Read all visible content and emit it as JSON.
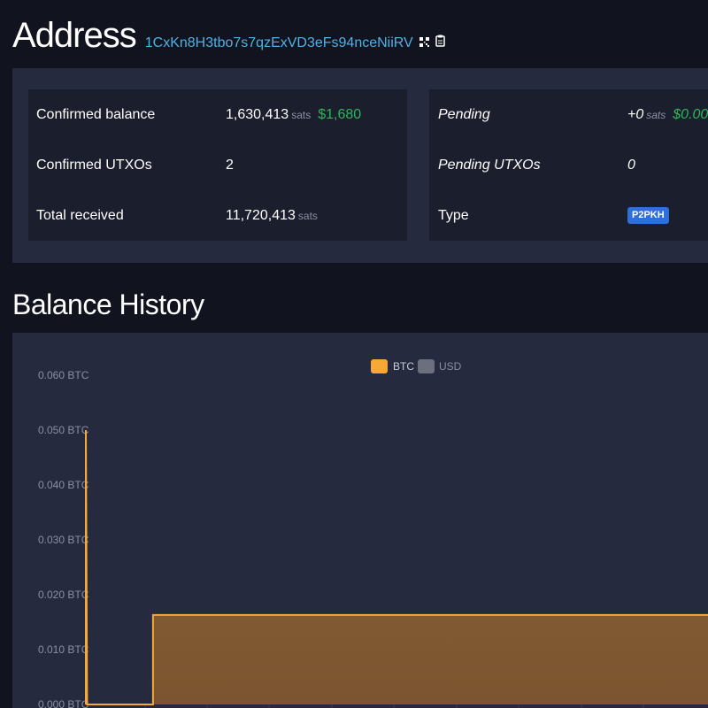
{
  "header": {
    "title": "Address",
    "address": "1CxKn8H3tbo7s7qzExVD3eFs94nceNiiRV",
    "icons": [
      "qr-code-icon",
      "clipboard-icon"
    ]
  },
  "summary": {
    "confirmed_balance": {
      "label": "Confirmed balance",
      "value": "1,630,413",
      "unit": "sats",
      "fiat": "$1,680"
    },
    "confirmed_utxos": {
      "label": "Confirmed UTXOs",
      "value": "2"
    },
    "total_received": {
      "label": "Total received",
      "value": "11,720,413",
      "unit": "sats"
    },
    "pending": {
      "label": "Pending",
      "value": "+0",
      "unit": "sats",
      "fiat": "$0.00"
    },
    "pending_utxos": {
      "label": "Pending UTXOs",
      "value": "0"
    },
    "type": {
      "label": "Type",
      "value": "P2PKH"
    }
  },
  "colors": {
    "background": "#11131f",
    "card": "#252a3e",
    "row": "#1b1e2c",
    "address_link": "#4fb2e6",
    "fiat_green": "#2fb55b",
    "badge_blue": "#2e6fdb",
    "btc_series": "#f7a835",
    "usd_series": "#6b6f7e"
  },
  "balance_history": {
    "title": "Balance History"
  },
  "chart_data": {
    "type": "area",
    "legend": [
      {
        "name": "BTC",
        "color": "#f7a835"
      },
      {
        "name": "USD",
        "color": "#6b6f7e"
      }
    ],
    "y_tick_labels": [
      "0.060 BTC",
      "0.050 BTC",
      "0.040 BTC",
      "0.030 BTC",
      "0.020 BTC",
      "0.010 BTC",
      "0.000 BTC"
    ],
    "y_ticks": [
      0.06,
      0.05,
      0.04,
      0.03,
      0.02,
      0.01,
      0.0
    ],
    "ylim": [
      0,
      0.06
    ],
    "xlim": [
      0,
      1
    ],
    "series": [
      {
        "name": "BTC",
        "points": [
          [
            0,
            0
          ],
          [
            0,
            0.05
          ],
          [
            0.002,
            0.0
          ],
          [
            0.108,
            0.0
          ],
          [
            0.108,
            0.0163
          ],
          [
            1,
            0.0163
          ]
        ]
      }
    ],
    "legend_position": "top-center",
    "grid": false
  }
}
